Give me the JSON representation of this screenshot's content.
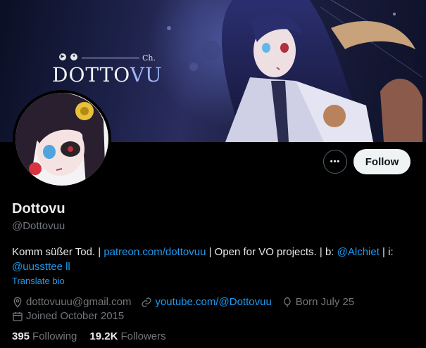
{
  "banner": {
    "logo_text_main": "DOTTO",
    "logo_text_accent": "VU",
    "logo_suffix": "Ch."
  },
  "profile": {
    "name": "Dottovu",
    "handle": "@Dottovuu",
    "bio": {
      "part1": "Komm süßer Tod. | ",
      "link1": "patreon.com/dottovuu",
      "part2": " | Open for VO projects. | b: ",
      "link2": "@Alchiet",
      "part3": " | i: ",
      "link3": "@uussttee ll"
    },
    "translate_label": "Translate bio",
    "email": "dottovuuu@gmail.com",
    "website": "youtube.com/@Dottovuu",
    "birthday": "Born July 25",
    "joined": "Joined October 2015"
  },
  "actions": {
    "more_label": "•••",
    "follow_label": "Follow"
  },
  "stats": {
    "following_count": "395",
    "following_label": "Following",
    "followers_count": "19.2K",
    "followers_label": "Followers"
  },
  "colors": {
    "accent": "#1d9bf0",
    "muted": "#71767b",
    "text": "#e7e9ea",
    "background": "#000000"
  },
  "icons": [
    "more-icon",
    "location-icon",
    "link-icon",
    "balloon-icon",
    "calendar-icon"
  ]
}
